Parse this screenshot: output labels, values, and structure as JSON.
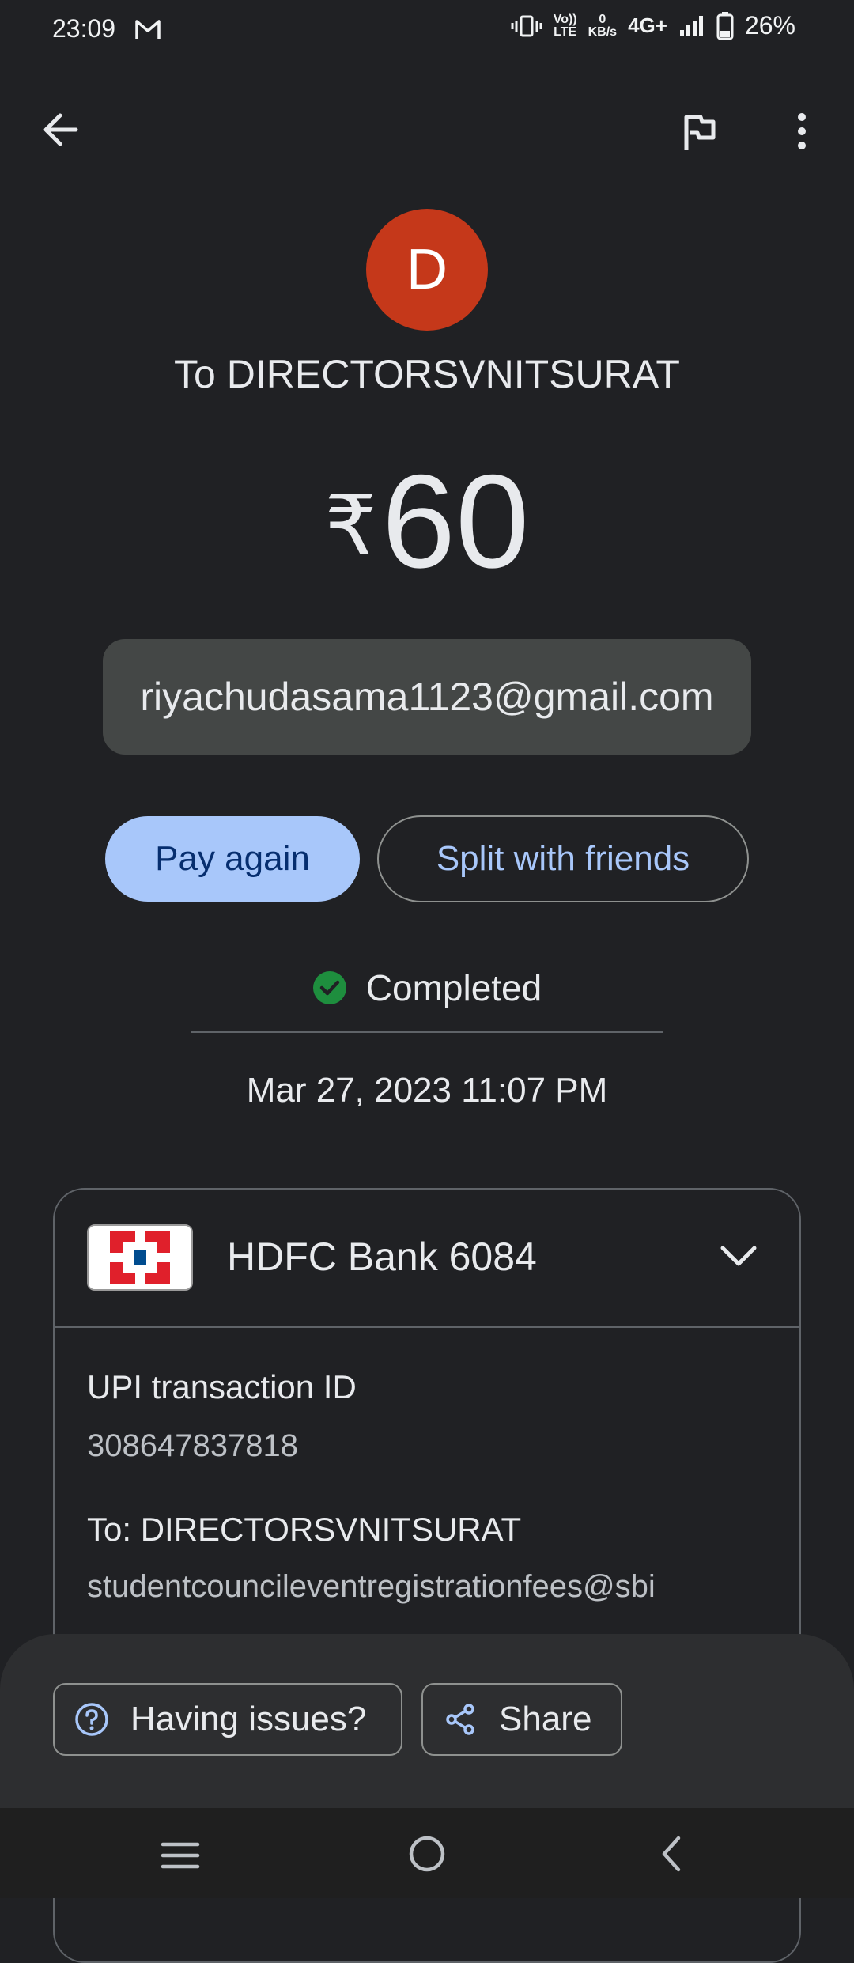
{
  "status_bar": {
    "time": "23:09",
    "volte_top": "Vo))",
    "volte_bottom": "LTE",
    "speed_top": "0",
    "speed_bottom": "KB/s",
    "network": "4G+",
    "battery": "26%"
  },
  "header": {
    "avatar_letter": "D",
    "avatar_color": "#c5381a",
    "recipient_title": "To DIRECTORSVNITSURAT",
    "currency": "₹",
    "amount": "60",
    "note": "riyachudasama1123@gmail.com"
  },
  "actions": {
    "pay_again": "Pay again",
    "split": "Split with friends"
  },
  "transaction": {
    "status": "Completed",
    "status_color": "#1e8e3e",
    "datetime": "Mar 27, 2023 11:07 PM"
  },
  "details": {
    "bank": "HDFC Bank 6084",
    "upi_label": "UPI transaction ID",
    "upi_id": "308647837818",
    "to_label": "To: DIRECTORSVNITSURAT",
    "to_upi": "studentcouncileventregistrationfees@sbi"
  },
  "bottom_actions": {
    "issues": "Having issues?",
    "share": "Share"
  },
  "icons": [
    "gmail-icon",
    "back-arrow-icon",
    "flag-icon",
    "more-vert-icon",
    "check-circle-icon",
    "chevron-down-icon",
    "help-icon",
    "share-icon",
    "menu-icon",
    "home-icon",
    "nav-back-icon"
  ]
}
